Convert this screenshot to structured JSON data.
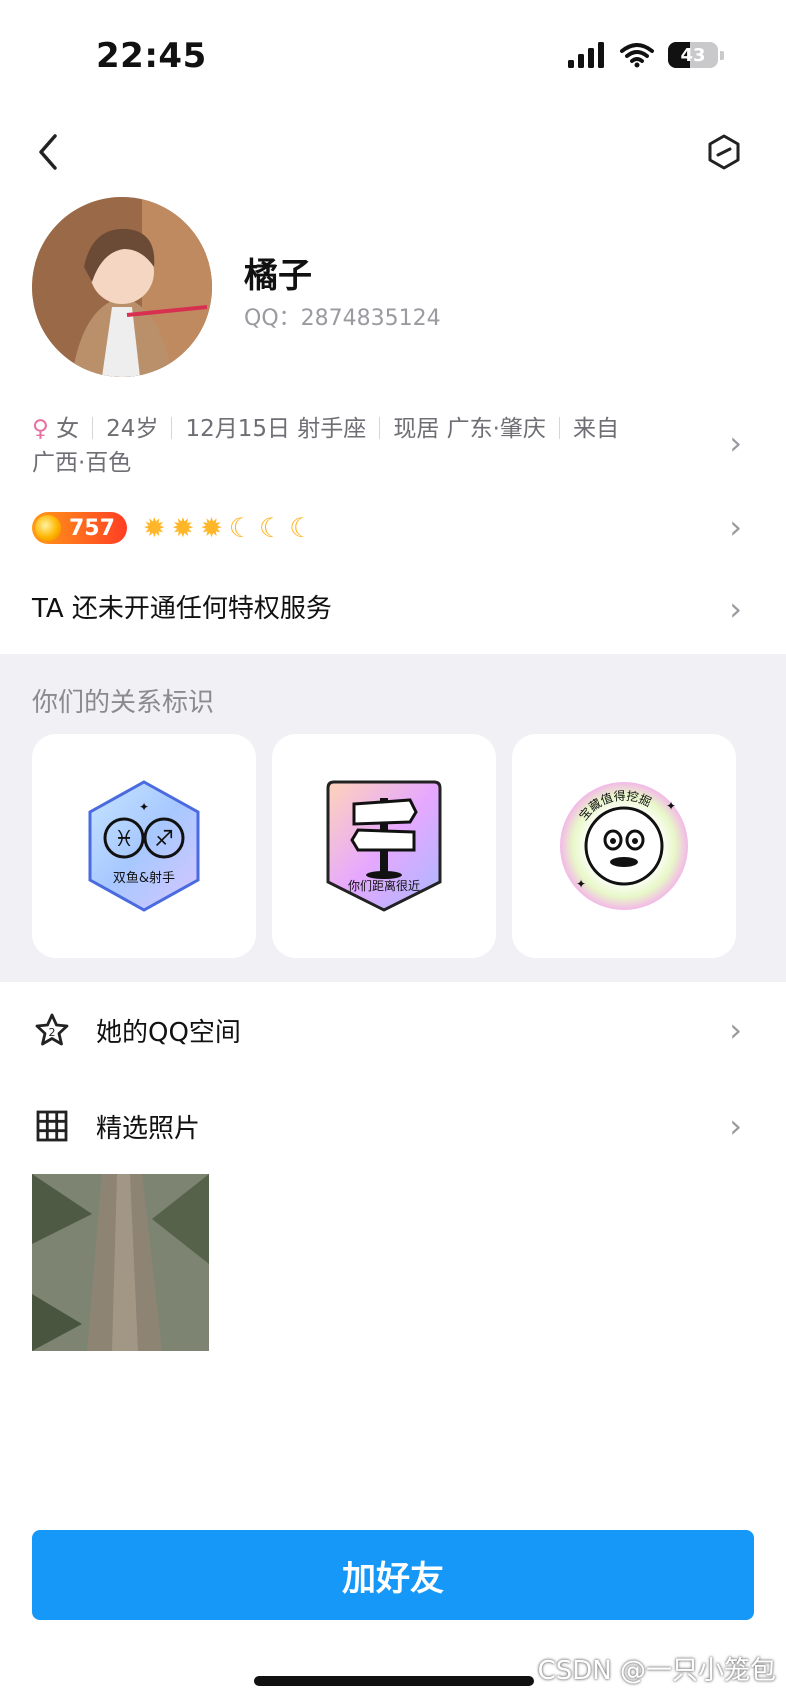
{
  "status_bar": {
    "time": "22:45",
    "battery": "43"
  },
  "profile": {
    "nickname": "橘子",
    "qq_id": "QQ：2874835124",
    "gender_symbol": "♀",
    "gender": "女",
    "age": "24岁",
    "birthday": "12月15日 射手座",
    "residence": "现居 广东·肇庆",
    "hometown_prefix": "来自",
    "hometown": "广西·百色",
    "level": "757",
    "privilege_text": "TA 还未开通任何特权服务"
  },
  "relation": {
    "title": "你们的关系标识",
    "badges": [
      {
        "label": "双鱼&射手",
        "icon": "zodiac-badge"
      },
      {
        "label": "你们距离很近",
        "icon": "signpost-badge"
      },
      {
        "label": "宝藏值得挖掘",
        "icon": "treasure-face-badge"
      }
    ]
  },
  "menu": {
    "qzone_label": "她的QQ空间",
    "photos_label": "精选照片"
  },
  "add_friend_label": "加好友",
  "watermark": "CSDN @一只小笼包",
  "colors": {
    "accent": "#1698f8",
    "gender": "#e86fa0",
    "level_gradient_start": "#ff9a18",
    "level_gradient_end": "#ff3e24"
  }
}
